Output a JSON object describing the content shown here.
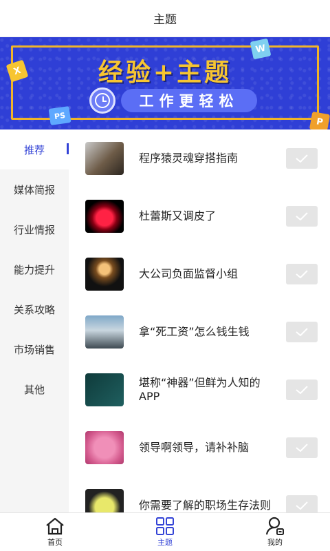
{
  "header": {
    "title": "主题"
  },
  "banner": {
    "headline": "经验+主题",
    "subline": "工作更轻松",
    "tiles": [
      "X",
      "W",
      "P",
      "PS"
    ]
  },
  "sidebar": {
    "items": [
      {
        "label": "推荐",
        "active": true
      },
      {
        "label": "媒体简报"
      },
      {
        "label": "行业情报"
      },
      {
        "label": "能力提升"
      },
      {
        "label": "关系攻略"
      },
      {
        "label": "市场销售"
      },
      {
        "label": "其他"
      }
    ]
  },
  "list": {
    "items": [
      {
        "title": "程序猿灵魂穿搭指南"
      },
      {
        "title": "杜蕾斯又调皮了"
      },
      {
        "title": "大公司负面监督小组"
      },
      {
        "title": "拿“死工资”怎么钱生钱"
      },
      {
        "title": "堪称“神器”但鲜为人知的APP"
      },
      {
        "title": "领导啊领导，请补补脑"
      },
      {
        "title": "你需要了解的职场生存法则"
      }
    ]
  },
  "tabbar": {
    "tabs": [
      {
        "label": "首页",
        "icon": "home-icon"
      },
      {
        "label": "主题",
        "icon": "grid-icon",
        "active": true
      },
      {
        "label": "我的",
        "icon": "user-icon"
      }
    ]
  },
  "colors": {
    "accent": "#3343d6",
    "banner_bg": "#2f3fd6",
    "banner_gold": "#f7c531"
  }
}
